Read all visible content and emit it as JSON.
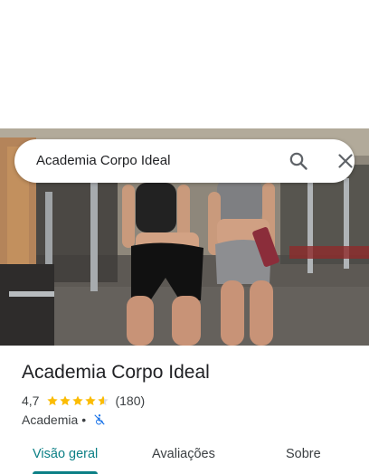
{
  "search": {
    "query": "Academia Corpo Ideal"
  },
  "place": {
    "title": "Academia Corpo Ideal",
    "rating": "4,7",
    "stars": 4.7,
    "reviews": "(180)",
    "category": "Academia",
    "separator": "•",
    "accessibility_icon": "no-wheelchair-access-icon"
  },
  "tabs": [
    {
      "label": "Visão geral",
      "active": true
    },
    {
      "label": "Avaliações",
      "active": false
    },
    {
      "label": "Sobre",
      "active": false
    }
  ],
  "colors": {
    "accent": "#0b7f85",
    "star": "#fbbc04",
    "text": "#202124",
    "secondary_text": "#3c4043",
    "accessibility_icon": "#1a73e8"
  }
}
